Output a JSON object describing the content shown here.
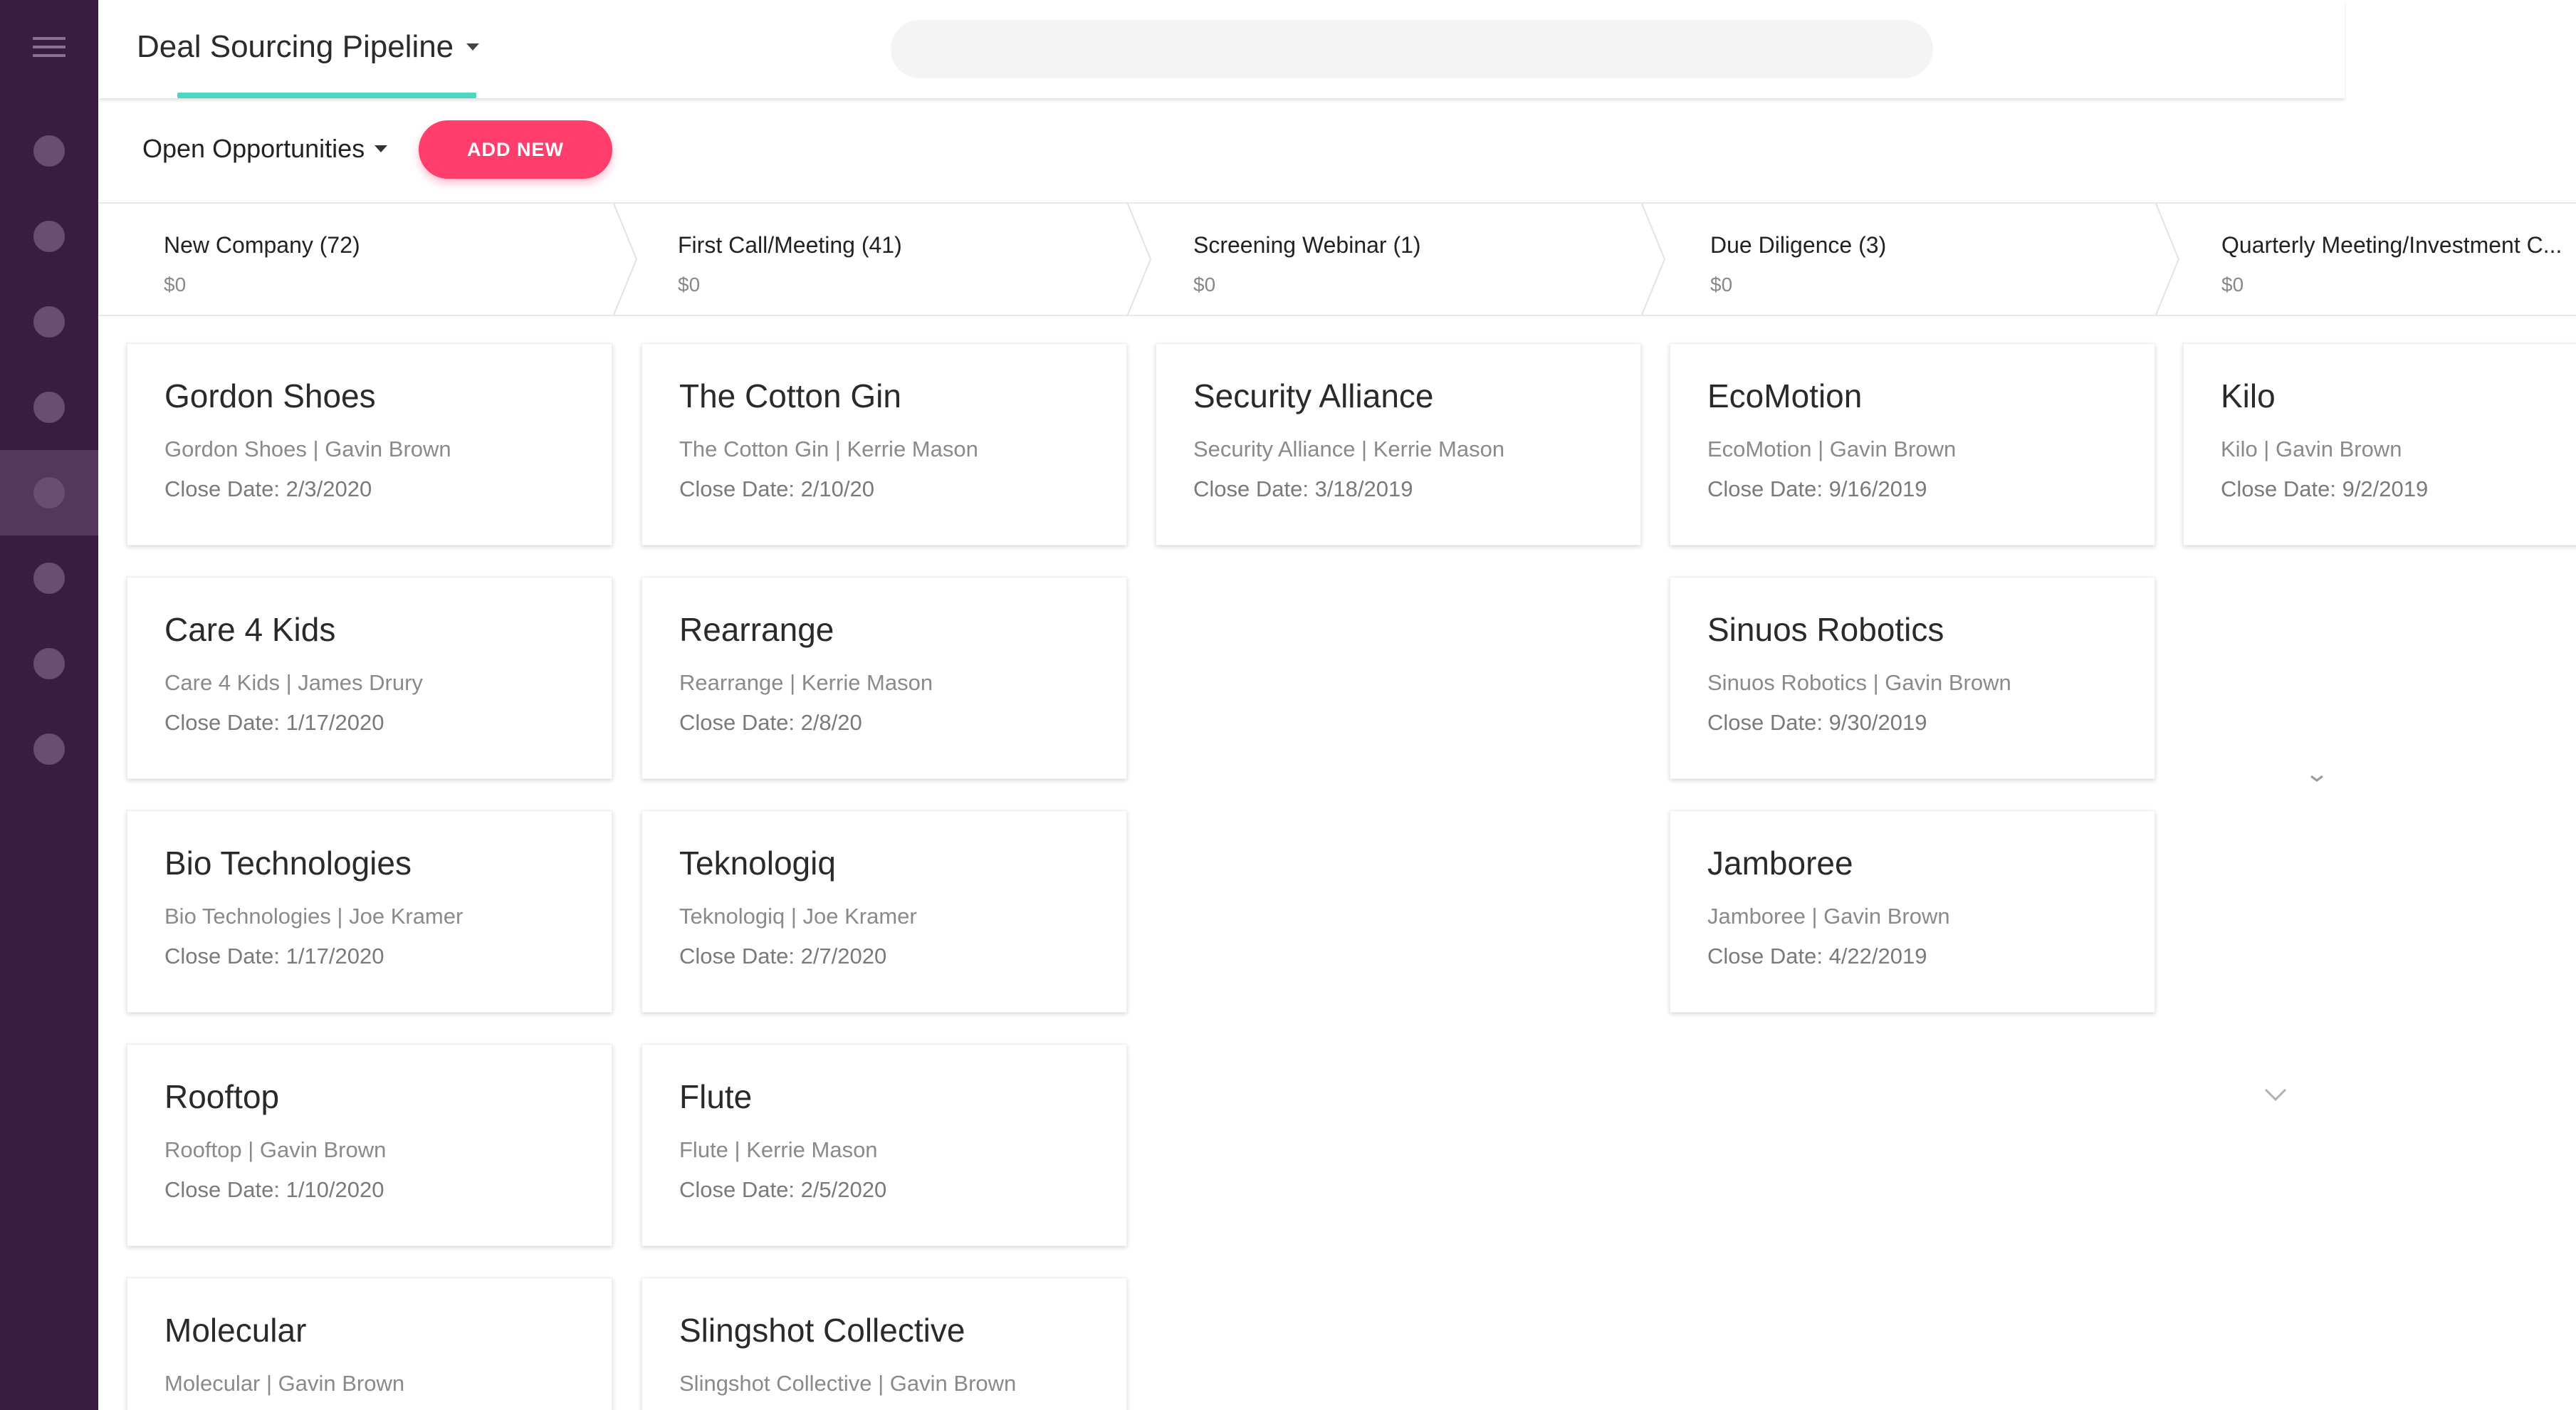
{
  "app": {
    "page_title": "Deal Sourcing Pipeline",
    "search_placeholder": ""
  },
  "toolbar": {
    "filter_label": "Open Opportunities",
    "add_button_label": "ADD NEW"
  },
  "sidebar": {
    "items": [
      {
        "icon": "nav-icon-1",
        "active": false
      },
      {
        "icon": "nav-icon-2",
        "active": false
      },
      {
        "icon": "nav-icon-3",
        "active": false
      },
      {
        "icon": "nav-icon-4",
        "active": false
      },
      {
        "icon": "nav-icon-5",
        "active": true
      },
      {
        "icon": "nav-icon-6",
        "active": false
      },
      {
        "icon": "nav-icon-7",
        "active": false
      },
      {
        "icon": "nav-icon-8",
        "active": false
      }
    ]
  },
  "stages": [
    {
      "name": "New Company (72)",
      "amount": "$0"
    },
    {
      "name": "First Call/Meeting (41)",
      "amount": "$0"
    },
    {
      "name": "Screening Webinar (1)",
      "amount": "$0"
    },
    {
      "name": "Due Diligence (3)",
      "amount": "$0"
    },
    {
      "name": "Quarterly Meeting/Investment C...",
      "amount": "$0"
    }
  ],
  "columns": [
    {
      "cards": [
        {
          "title": "Gordon Shoes",
          "sub": "Gordon Shoes | Gavin Brown",
          "date": "Close Date: 2/3/2020"
        },
        {
          "title": "Care 4 Kids",
          "sub": "Care 4 Kids | James Drury",
          "date": "Close Date: 1/17/2020"
        },
        {
          "title": "Bio Technologies",
          "sub": "Bio Technologies | Joe Kramer",
          "date": "Close Date: 1/17/2020"
        },
        {
          "title": "Rooftop",
          "sub": "Rooftop | Gavin Brown",
          "date": "Close Date: 1/10/2020"
        },
        {
          "title": "Molecular",
          "sub": "Molecular | Gavin Brown",
          "date": ""
        }
      ]
    },
    {
      "cards": [
        {
          "title": "The Cotton Gin",
          "sub": "The Cotton Gin | Kerrie Mason",
          "date": "Close Date: 2/10/20"
        },
        {
          "title": "Rearrange",
          "sub": "Rearrange | Kerrie Mason",
          "date": "Close Date: 2/8/20"
        },
        {
          "title": "Teknologiq",
          "sub": "Teknologiq | Joe Kramer",
          "date": "Close Date: 2/7/2020"
        },
        {
          "title": "Flute",
          "sub": "Flute | Kerrie Mason",
          "date": "Close Date: 2/5/2020"
        },
        {
          "title": "Slingshot Collective",
          "sub": "Slingshot Collective | Gavin Brown",
          "date": ""
        }
      ]
    },
    {
      "cards": [
        {
          "title": "Security Alliance",
          "sub": "Security Alliance | Kerrie Mason",
          "date": "Close Date: 3/18/2019"
        }
      ]
    },
    {
      "cards": [
        {
          "title": "EcoMotion",
          "sub": "EcoMotion | Gavin Brown",
          "date": "Close Date: 9/16/2019"
        },
        {
          "title": "Sinuos Robotics",
          "sub": "Sinuos Robotics | Gavin Brown",
          "date": "Close Date: 9/30/2019"
        },
        {
          "title": "Jamboree",
          "sub": "Jamboree | Gavin Brown",
          "date": "Close Date: 4/22/2019"
        }
      ]
    },
    {
      "cards": [
        {
          "title": "Kilo",
          "sub": "Kilo | Gavin Brown",
          "date": "Close Date: 9/2/2019"
        }
      ]
    }
  ],
  "colors": {
    "sidebar_bg": "#3a1c42",
    "accent_teal": "#4fd6c3",
    "accent_pink": "#ff3e6c"
  }
}
